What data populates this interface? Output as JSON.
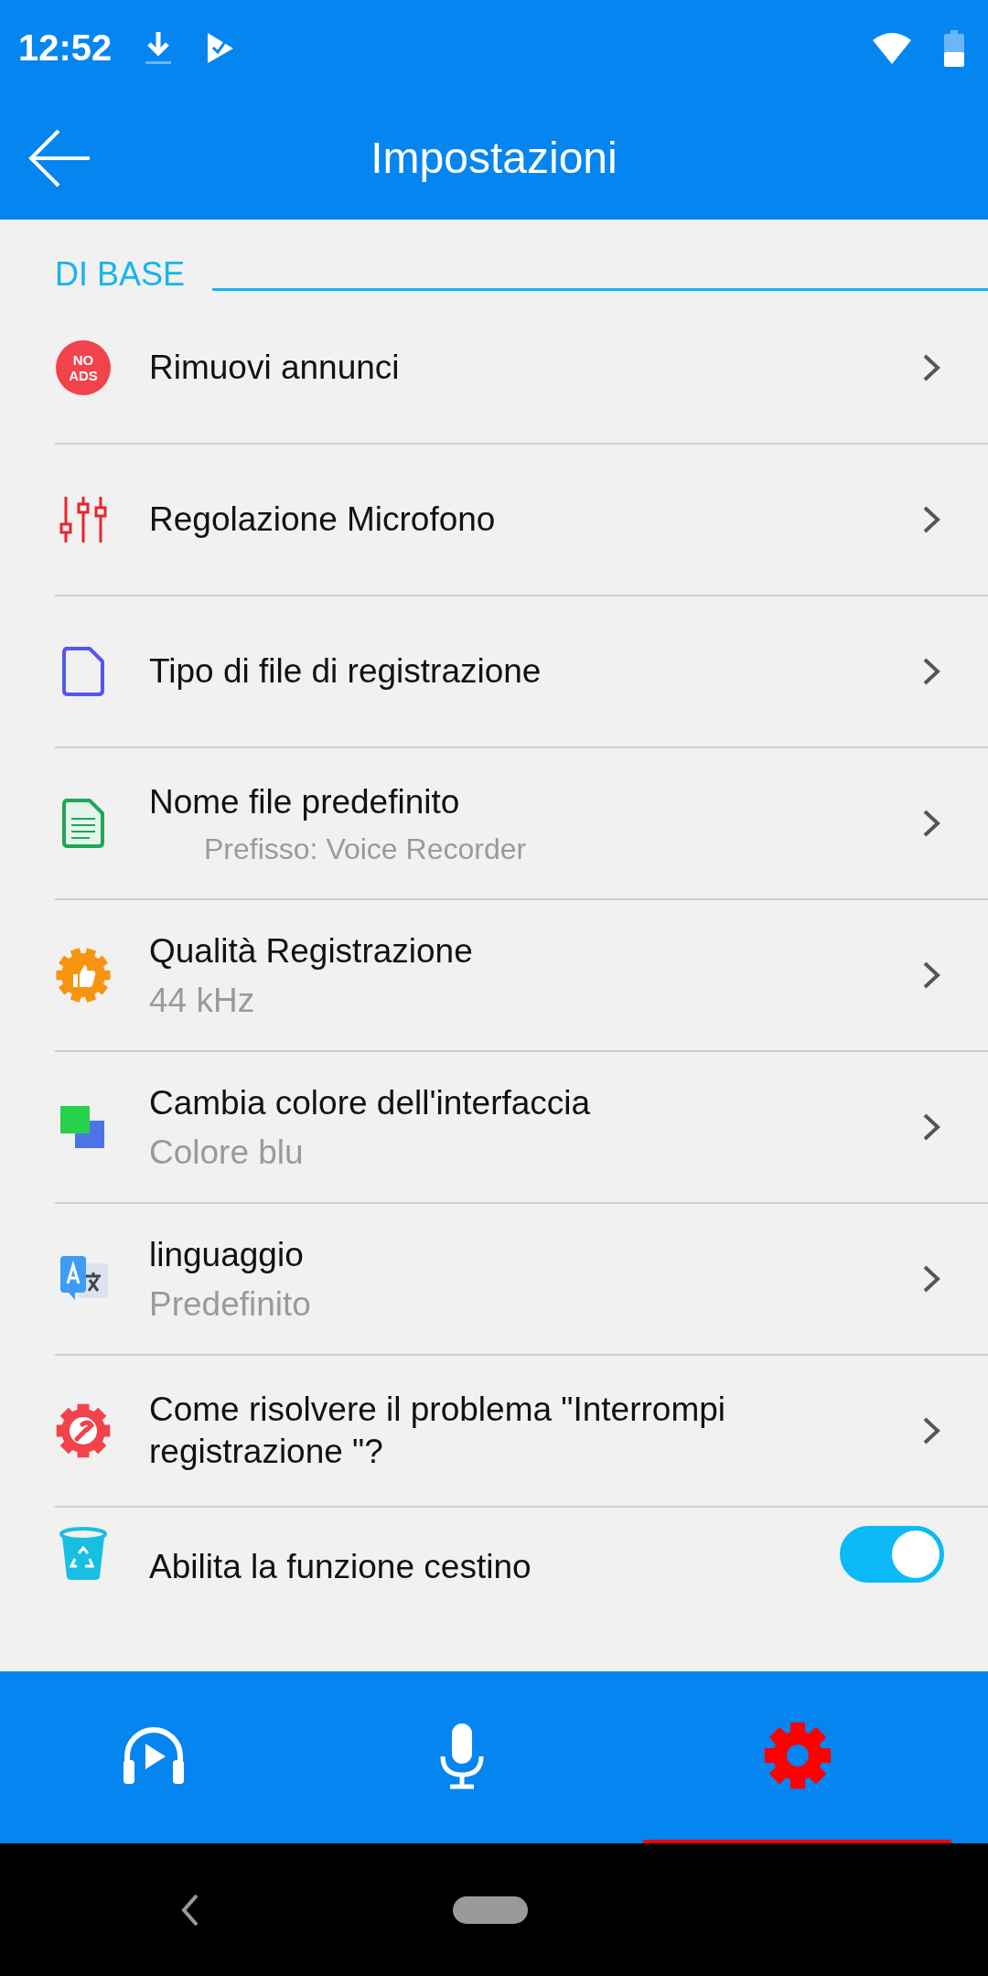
{
  "status_bar": {
    "time": "12:52"
  },
  "app_bar": {
    "title": "Impostazioni"
  },
  "section": {
    "title": "DI BASE"
  },
  "items": [
    {
      "kind": "nav",
      "icon_text": [
        "NO",
        "ADS"
      ],
      "title": "Rimuovi annunci"
    },
    {
      "kind": "nav",
      "title": "Regolazione Microfono"
    },
    {
      "kind": "nav",
      "title": "Tipo di file di registrazione"
    },
    {
      "kind": "nav",
      "title": "Nome file predefinito",
      "hint": "Prefisso: Voice Recorder"
    },
    {
      "kind": "nav",
      "title": "Qualità Registrazione",
      "subtitle": "44 kHz"
    },
    {
      "kind": "nav",
      "title": "Cambia colore dell'interfaccia",
      "subtitle": "Colore blu"
    },
    {
      "kind": "nav",
      "title": "linguaggio",
      "subtitle": "Predefinito"
    },
    {
      "kind": "nav",
      "title": "Come risolvere il problema \"Interrompi registrazione \"?"
    },
    {
      "kind": "toggle",
      "title": "Abilita la funzione cestino",
      "on": true
    }
  ],
  "bottom_nav": [
    {
      "selected": false
    },
    {
      "selected": false
    },
    {
      "selected": true
    }
  ]
}
